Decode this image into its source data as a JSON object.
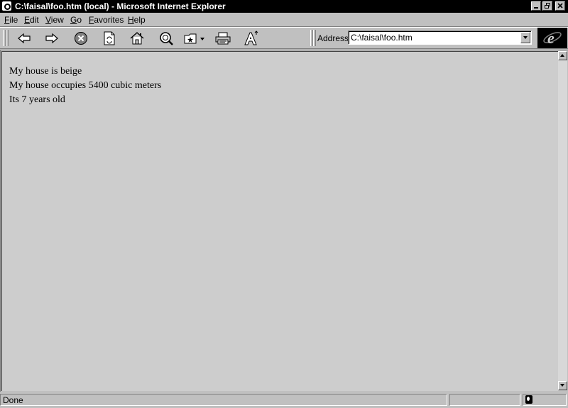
{
  "window": {
    "title": "C:\\faisal\\foo.htm (local) - Microsoft Internet Explorer",
    "minimize_icon": "minimize-icon",
    "restore_icon": "restore-icon",
    "close_icon": "close-icon"
  },
  "menu": [
    "File",
    "Edit",
    "View",
    "Go",
    "Favorites",
    "Help"
  ],
  "toolbar": {
    "buttons": [
      "back-icon",
      "forward-icon",
      "stop-icon",
      "refresh-icon",
      "home-icon",
      "search-icon",
      "favorites-icon",
      "print-icon",
      "font-icon"
    ],
    "address_label": "Address",
    "address_value": "C:\\faisal\\foo.htm"
  },
  "content": {
    "lines": [
      "My house is beige",
      "My house occupies 5400 cubic meters",
      "Its 7 years old"
    ]
  },
  "status": {
    "text": "Done"
  }
}
